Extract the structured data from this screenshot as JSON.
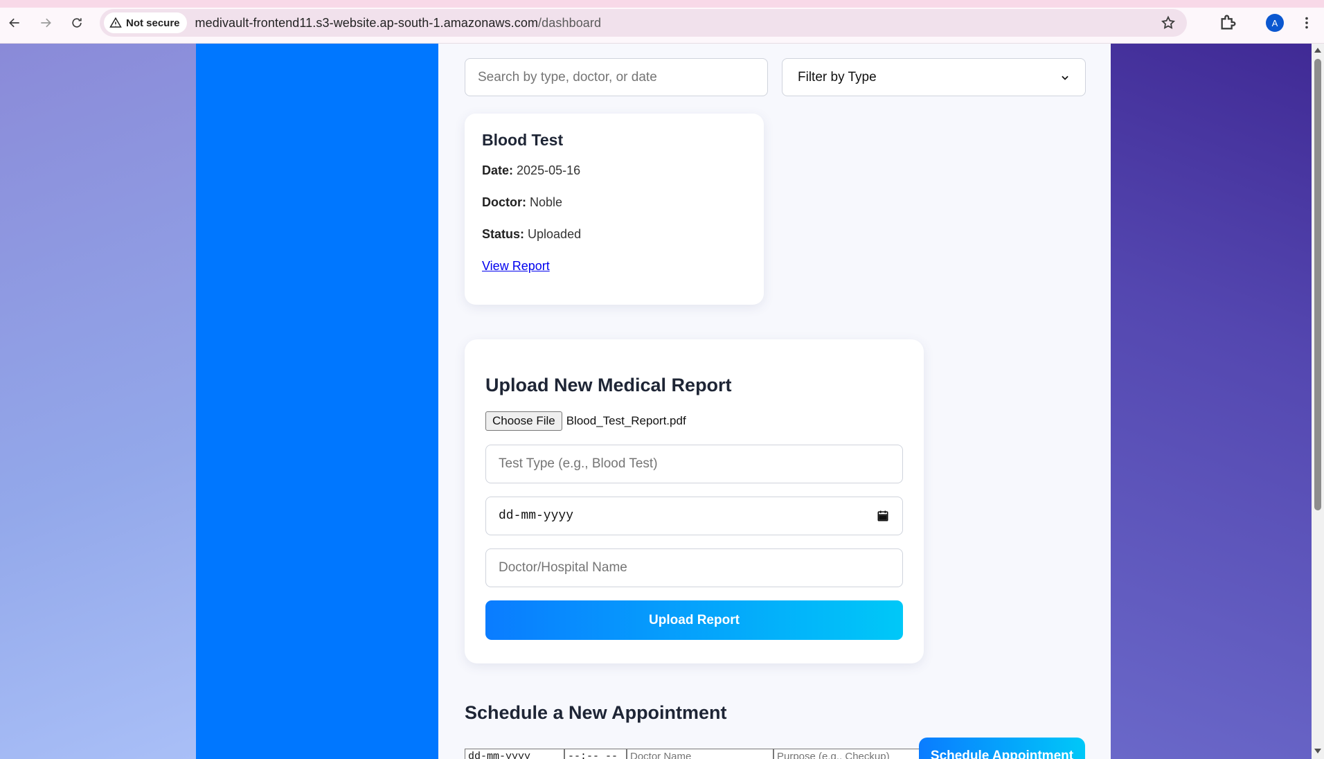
{
  "browser": {
    "security_label": "Not secure",
    "url_host": "medivault-frontend11.s3-website.ap-south-1.amazonaws.com",
    "url_path": "/dashboard",
    "profile_initial": "A"
  },
  "filters": {
    "search_placeholder": "Search by type, doctor, or date",
    "filter_label": "Filter by Type"
  },
  "report": {
    "title": "Blood Test",
    "date_label": "Date:",
    "date_value": "2025-05-16",
    "doctor_label": "Doctor:",
    "doctor_value": "Noble",
    "status_label": "Status:",
    "status_value": "Uploaded",
    "link_label": "View Report"
  },
  "upload": {
    "title": "Upload New Medical Report",
    "choose_file_label": "Choose File",
    "file_name": "Blood_Test_Report.pdf",
    "test_type_placeholder": "Test Type (e.g., Blood Test)",
    "date_placeholder": "dd-mm-yyyy",
    "doctor_placeholder": "Doctor/Hospital Name",
    "submit_label": "Upload Report"
  },
  "appointment": {
    "title": "Schedule a New Appointment",
    "date_placeholder": "dd-mm-yyyy",
    "time_placeholder": "--:-- --",
    "doctor_placeholder": "Doctor Name",
    "purpose_placeholder": "Purpose (e.g., Checkup)",
    "submit_label": "Schedule Appointment"
  },
  "colors": {
    "sidebar": "#0077ff",
    "accent_start": "#0a7cff",
    "accent_end": "#00c8f8",
    "link": "#0000ee"
  }
}
